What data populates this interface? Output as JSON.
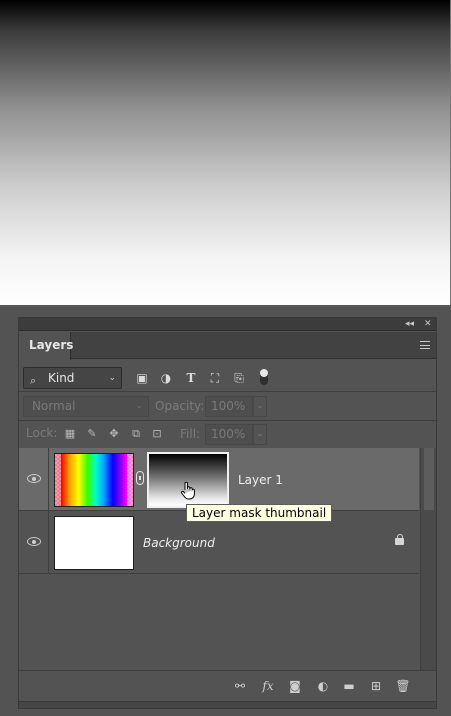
{
  "panel": {
    "collapse_glyph": "◂◂",
    "close_glyph": "✕",
    "tab_label": "Layers"
  },
  "filter": {
    "kind_label": "Kind",
    "icons": [
      "image-filter-icon",
      "adjustment-filter-icon",
      "type-filter-icon",
      "shape-filter-icon",
      "smart-object-filter-icon"
    ]
  },
  "blend": {
    "mode": "Normal",
    "opacity_label": "Opacity:",
    "opacity_value": "100%",
    "fill_label": "Fill:",
    "fill_value": "100%"
  },
  "lock": {
    "label": "Lock:",
    "icons": [
      "lock-transparent-icon",
      "lock-image-icon",
      "lock-position-icon",
      "lock-artboard-icon",
      "lock-all-icon"
    ]
  },
  "layers": [
    {
      "name": "Layer 1",
      "visible": true,
      "selected": true,
      "has_mask": true
    },
    {
      "name": "Background",
      "visible": true,
      "selected": false,
      "locked": true
    }
  ],
  "tooltip": {
    "text": "Layer mask thumbnail"
  },
  "bottom_bar": {
    "fx_label": "fx",
    "icons": [
      "link-layers-icon",
      "fx-icon",
      "add-mask-icon",
      "adjustment-layer-icon",
      "new-group-icon",
      "new-layer-icon",
      "delete-icon"
    ]
  },
  "colors": {
    "panel_bg": "#535353",
    "selected_row": "#6a6a6a",
    "tooltip_bg": "#ffffe1"
  }
}
